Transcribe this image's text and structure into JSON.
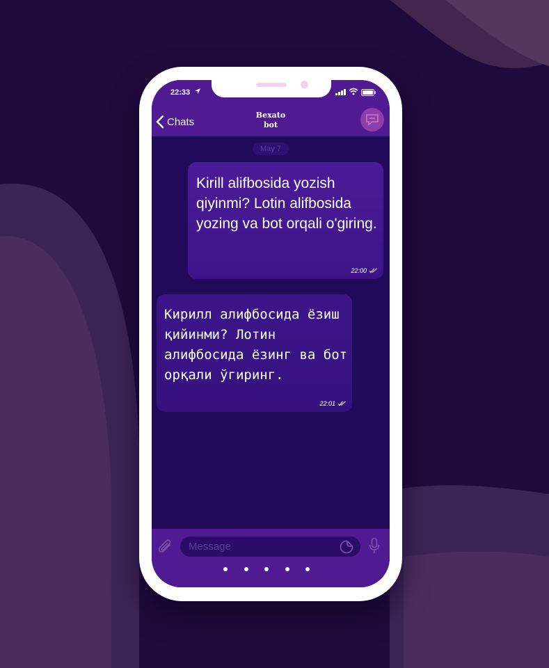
{
  "status_bar": {
    "time": "22:33",
    "location_icon": "location-arrow-icon",
    "signal_icon": "signal-icon",
    "wifi_icon": "wifi-icon",
    "battery_icon": "battery-icon"
  },
  "nav": {
    "back_label": "Chats",
    "title_line1": "Bexato",
    "title_line2": "bot"
  },
  "chat": {
    "date": "May 7",
    "messages": [
      {
        "text": "Kirill alifbosida yozish qiyinmi? Lotin alifbosida yozing va bot orqali o'giring.",
        "time": "22:00"
      },
      {
        "text": "Кирилл алифбосида ёзиш қийинми? Лотин алифбосида ёзинг ва бот орқали ўгиринг.",
        "time": "22:01"
      }
    ]
  },
  "input": {
    "placeholder": "Message"
  },
  "colors": {
    "background": "#200a3c",
    "bar": "#4f1a92",
    "chat_bg": "#210a5a",
    "bubble": "#451896",
    "input_field": "#2b0c66"
  }
}
